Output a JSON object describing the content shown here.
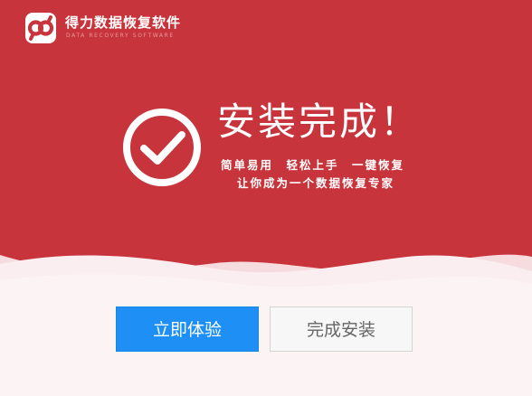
{
  "app": {
    "title": "得力数据恢复软件",
    "subtitle": "DATA RECOVERY SOFTWARE",
    "logo_icon": "infinity-logo-icon"
  },
  "main": {
    "status_icon": "check-circle-icon",
    "headline": "安装完成！",
    "tagline_line1": "简单易用　轻松上手　一键恢复",
    "tagline_line2": "让你成为一个数据恢复专家"
  },
  "actions": {
    "try_now_label": "立即体验",
    "finish_install_label": "完成安装"
  },
  "colors": {
    "brand_red": "#c8343c",
    "primary_blue": "#1d8ff5",
    "wave_pink": "#f9e6e8",
    "secondary_gray": "#f7f7f7"
  }
}
